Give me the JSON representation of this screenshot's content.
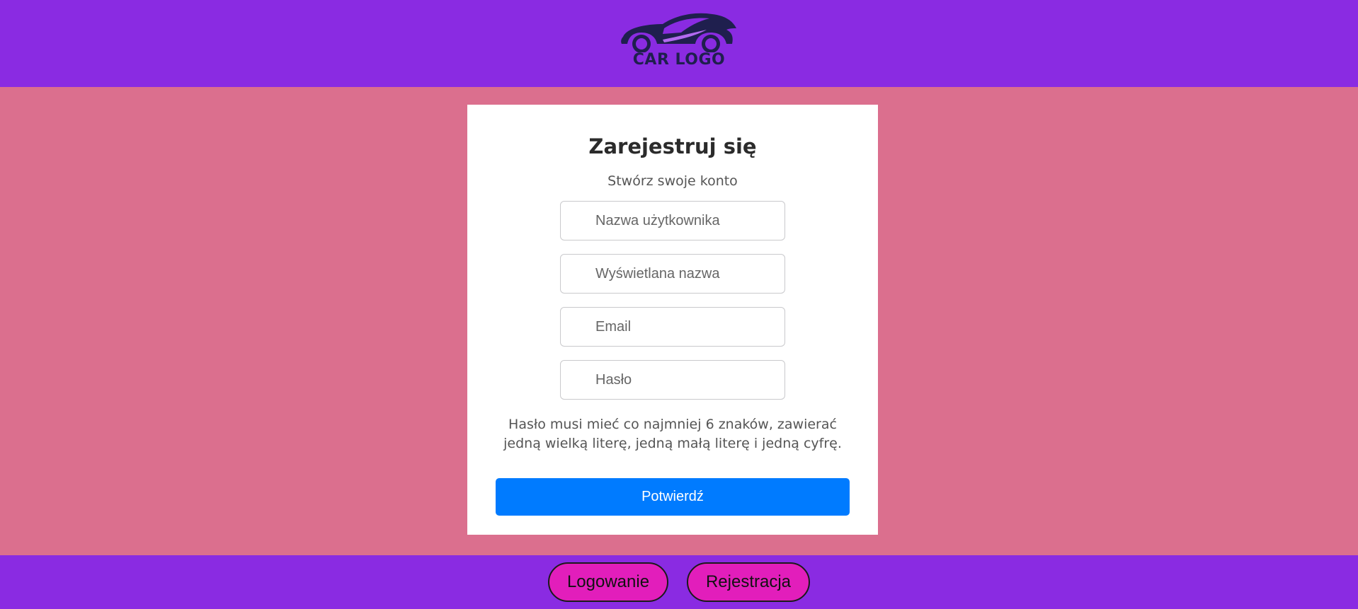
{
  "header": {
    "logo_text": "CAR LOGO",
    "colors": {
      "background": "#8a2be2",
      "logo": "#1f1f4e"
    }
  },
  "form": {
    "title": "Zarejestruj się",
    "subtitle": "Stwórz swoje konto",
    "fields": {
      "username": {
        "placeholder": "Nazwa użytkownika",
        "value": ""
      },
      "display_name": {
        "placeholder": "Wyświetlana nazwa",
        "value": ""
      },
      "email": {
        "placeholder": "Email",
        "value": ""
      },
      "password": {
        "placeholder": "Hasło",
        "value": ""
      }
    },
    "password_hint": "Hasło musi mieć co najmniej 6 znaków, zawierać jedną wielką literę, jedną małą literę i jedną cyfrę.",
    "submit_label": "Potwierdź"
  },
  "footer": {
    "login_label": "Logowanie",
    "register_label": "Rejestracja"
  },
  "colors": {
    "page_background": "#db6f8e",
    "bar_background": "#8a2be2",
    "submit_button": "#007bff",
    "nav_button": "#e21ebb"
  }
}
